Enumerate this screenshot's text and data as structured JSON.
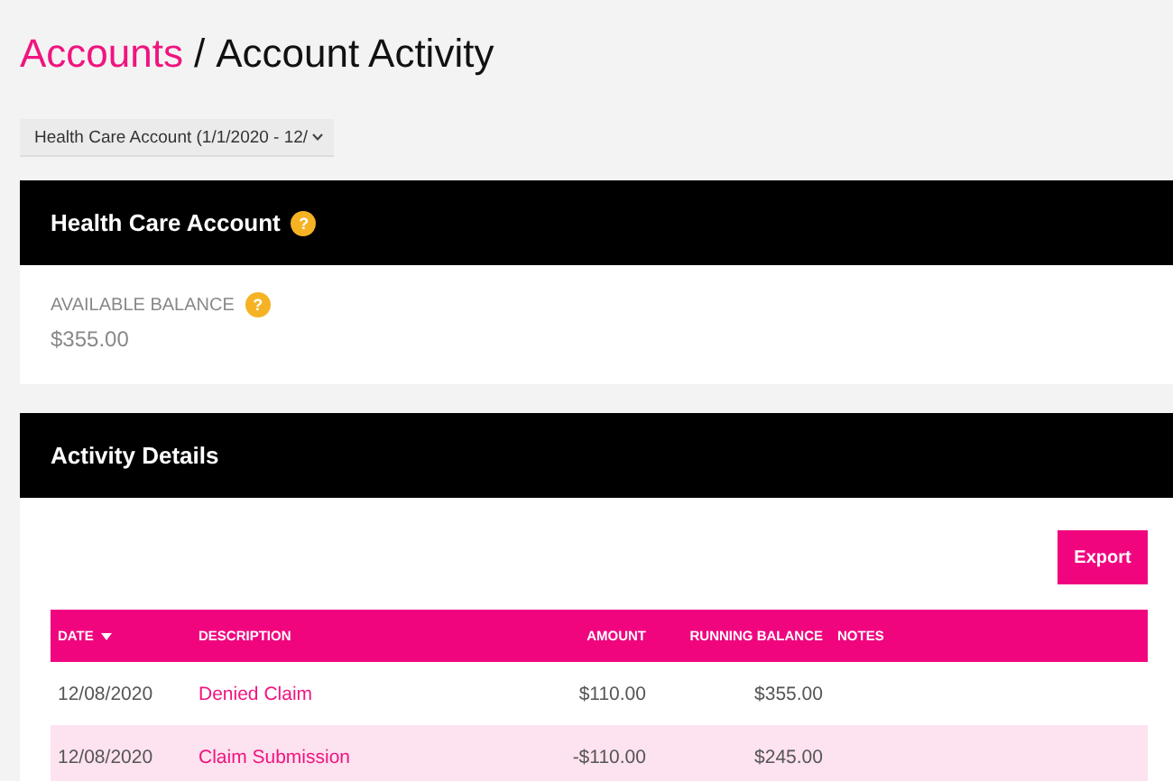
{
  "breadcrumb": {
    "parent": "Accounts",
    "separator": "/",
    "current": "Account Activity"
  },
  "account_select": {
    "value": "Health Care Account (1/1/2020 - 12/"
  },
  "account_panel": {
    "title": "Health Care Account",
    "title_help": "?",
    "balance_label": "AVAILABLE BALANCE",
    "balance_help": "?",
    "balance": "$355.00"
  },
  "activity_panel": {
    "title": "Activity Details",
    "export_button": "Export",
    "table": {
      "columns": [
        {
          "label": "DATE",
          "kind": "text",
          "sorted": true
        },
        {
          "label": "DESCRIPTION",
          "kind": "text",
          "sorted": false
        },
        {
          "label": "AMOUNT",
          "kind": "money",
          "sorted": false
        },
        {
          "label": "RUNNING BALANCE",
          "kind": "money",
          "sorted": false
        },
        {
          "label": "NOTES",
          "kind": "text",
          "sorted": false
        }
      ],
      "rows": [
        {
          "date": "12/08/2020",
          "description": "Denied Claim",
          "amount": "$110.00",
          "running_balance": "$355.00"
        },
        {
          "date": "12/08/2020",
          "description": "Claim Submission",
          "amount": "-$110.00",
          "running_balance": "$245.00"
        }
      ]
    }
  }
}
